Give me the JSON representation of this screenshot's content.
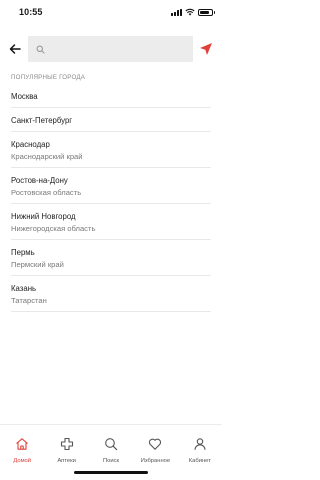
{
  "status_bar": {
    "time": "10:55",
    "battery_level": 0.85
  },
  "search": {
    "placeholder": "",
    "value": ""
  },
  "colors": {
    "accent": "#e0403a",
    "separator": "#e8e8e8",
    "search_bg": "#ececec"
  },
  "popular": {
    "title": "ПОПУЛЯРНЫЕ ГОРОДА",
    "cities": [
      {
        "name": "Москва",
        "region": ""
      },
      {
        "name": "Санкт-Петербург",
        "region": ""
      },
      {
        "name": "Краснодар",
        "region": "Краснодарский край"
      },
      {
        "name": "Ростов-на-Дону",
        "region": "Ростовская область"
      },
      {
        "name": "Нижний Новгород",
        "region": "Нижегородская область"
      },
      {
        "name": "Пермь",
        "region": "Пермский край"
      },
      {
        "name": "Казань",
        "region": "Татарстан"
      }
    ]
  },
  "tabbar": {
    "items": [
      {
        "label": "Домой",
        "icon": "home-icon",
        "active": true
      },
      {
        "label": "Аптеки",
        "icon": "pharmacy-cross-icon",
        "active": false
      },
      {
        "label": "Поиск",
        "icon": "search-icon",
        "active": false
      },
      {
        "label": "Избранное",
        "icon": "heart-icon",
        "active": false
      },
      {
        "label": "Кабинет",
        "icon": "profile-icon",
        "active": false
      }
    ]
  }
}
